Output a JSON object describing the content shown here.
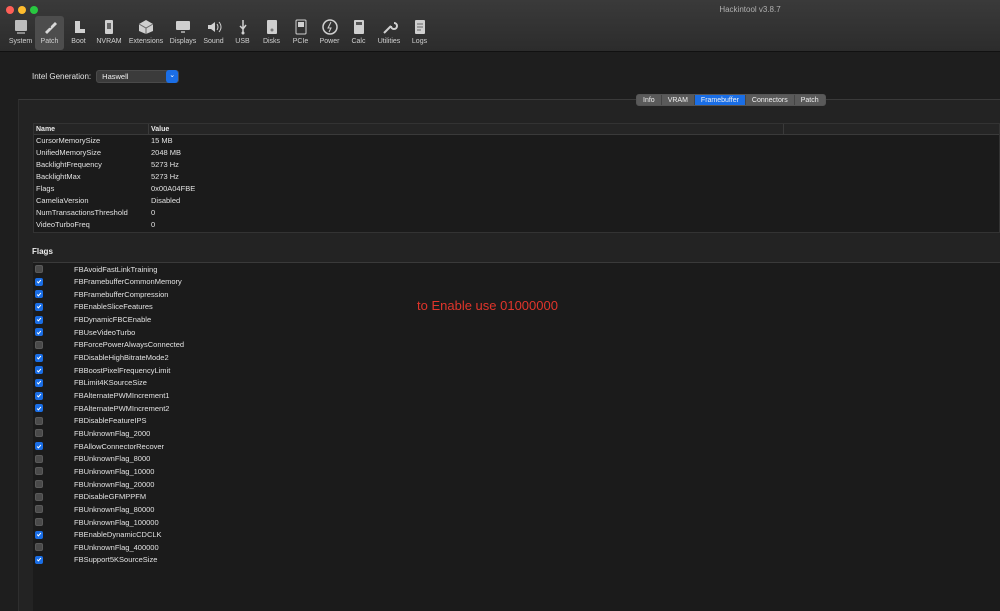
{
  "window": {
    "title": "Hackintool v3.8.7"
  },
  "toolbar": [
    {
      "label": "System",
      "icon": "system-icon"
    },
    {
      "label": "Patch",
      "icon": "patch-icon",
      "selected": true
    },
    {
      "label": "Boot",
      "icon": "boot-icon"
    },
    {
      "label": "NVRAM",
      "icon": "nvram-icon"
    },
    {
      "label": "Extensions",
      "icon": "extensions-icon"
    },
    {
      "label": "Displays",
      "icon": "displays-icon"
    },
    {
      "label": "Sound",
      "icon": "sound-icon"
    },
    {
      "label": "USB",
      "icon": "usb-icon"
    },
    {
      "label": "Disks",
      "icon": "disks-icon"
    },
    {
      "label": "PCIe",
      "icon": "pcie-icon"
    },
    {
      "label": "Power",
      "icon": "power-icon"
    },
    {
      "label": "Calc",
      "icon": "calc-icon"
    },
    {
      "label": "Utilities",
      "icon": "utilities-icon"
    },
    {
      "label": "Logs",
      "icon": "logs-icon"
    }
  ],
  "generation": {
    "label": "Intel Generation:",
    "value": "Haswell"
  },
  "tabs": [
    {
      "label": "Info"
    },
    {
      "label": "VRAM"
    },
    {
      "label": "Framebuffer",
      "active": true
    },
    {
      "label": "Connectors"
    },
    {
      "label": "Patch"
    }
  ],
  "properties": {
    "columns": [
      "Name",
      "Value"
    ],
    "rows": [
      [
        "CursorMemorySize",
        "15 MB"
      ],
      [
        "UnifiedMemorySize",
        "2048 MB"
      ],
      [
        "BacklightFrequency",
        "5273 Hz"
      ],
      [
        "BacklightMax",
        "5273 Hz"
      ],
      [
        "Flags",
        "0x00A04FBE"
      ],
      [
        "CameliaVersion",
        "Disabled"
      ],
      [
        "NumTransactionsThreshold",
        "0"
      ],
      [
        "VideoTurboFreq",
        "0"
      ]
    ]
  },
  "flags": {
    "heading": "Flags",
    "items": [
      {
        "name": "FBAvoidFastLinkTraining",
        "checked": false
      },
      {
        "name": "FBFramebufferCommonMemory",
        "checked": true
      },
      {
        "name": "FBFramebufferCompression",
        "checked": true
      },
      {
        "name": "FBEnableSliceFeatures",
        "checked": true
      },
      {
        "name": "FBDynamicFBCEnable",
        "checked": true
      },
      {
        "name": "FBUseVideoTurbo",
        "checked": true
      },
      {
        "name": "FBForcePowerAlwaysConnected",
        "checked": false
      },
      {
        "name": "FBDisableHighBitrateMode2",
        "checked": true
      },
      {
        "name": "FBBoostPixelFrequencyLimit",
        "checked": true
      },
      {
        "name": "FBLimit4KSourceSize",
        "checked": true
      },
      {
        "name": "FBAlternatePWMIncrement1",
        "checked": true
      },
      {
        "name": "FBAlternatePWMIncrement2",
        "checked": true
      },
      {
        "name": "FBDisableFeatureIPS",
        "checked": false
      },
      {
        "name": "FBUnknownFlag_2000",
        "checked": false
      },
      {
        "name": "FBAllowConnectorRecover",
        "checked": true
      },
      {
        "name": "FBUnknownFlag_8000",
        "checked": false
      },
      {
        "name": "FBUnknownFlag_10000",
        "checked": false
      },
      {
        "name": "FBUnknownFlag_20000",
        "checked": false
      },
      {
        "name": "FBDisableGFMPPFM",
        "checked": false
      },
      {
        "name": "FBUnknownFlag_80000",
        "checked": false
      },
      {
        "name": "FBUnknownFlag_100000",
        "checked": false
      },
      {
        "name": "FBEnableDynamicCDCLK",
        "checked": true
      },
      {
        "name": "FBUnknownFlag_400000",
        "checked": false
      },
      {
        "name": "FBSupport5KSourceSize",
        "checked": true
      }
    ]
  },
  "annotation": {
    "text": "to Enable use 01000000",
    "color": "#e0352b"
  },
  "colors": {
    "accent": "#1a6ee6",
    "background": "#1e1e1e"
  }
}
